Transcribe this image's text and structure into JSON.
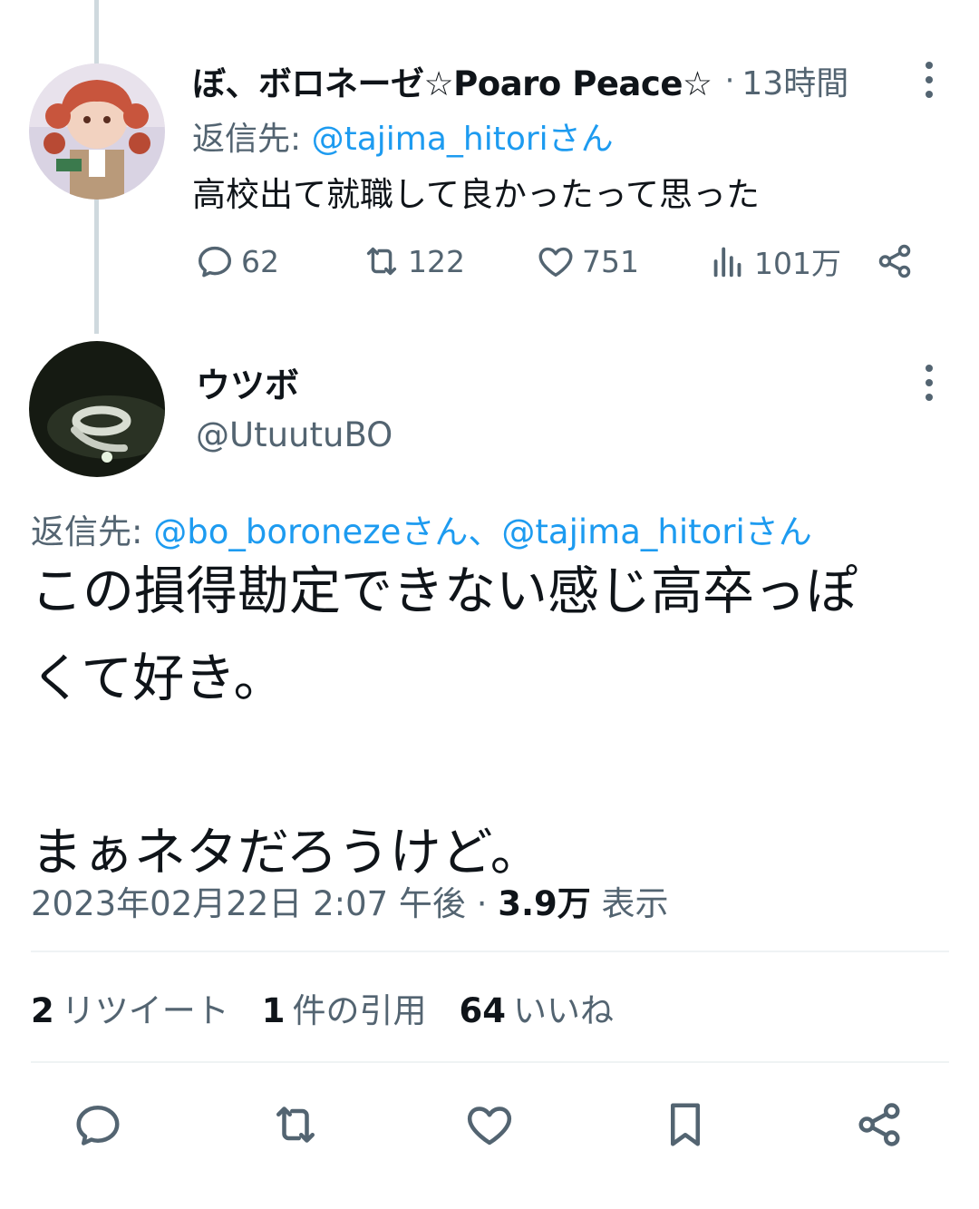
{
  "parent_tweet": {
    "display_name": "ぼ、ボロネーゼ☆Poaro Peace☆",
    "separator": "·",
    "time": "13時間",
    "reply_to_prefix": "返信先: ",
    "reply_to_handle": "@tajima_hitori",
    "reply_to_suffix": "さん",
    "text": "高校出て就職して良かったって思った",
    "replies": "62",
    "retweets": "122",
    "likes": "751",
    "views": "101万"
  },
  "reply_tweet": {
    "display_name": "ウツボ",
    "handle": "@UtuutuBO",
    "reply_to_prefix": "返信先: ",
    "reply_to_handle_1": "@bo_boroneze",
    "reply_to_join": "さん、",
    "reply_to_handle_2": "@tajima_hitori",
    "reply_to_suffix": "さん",
    "body_lines": [
      "この損得勘定できない感じ高卒っぽ",
      "くて好き。",
      "",
      "まぁネタだろうけど。"
    ],
    "timestamp": "2023年02月22日 2:07 午後",
    "meta_separator": " · ",
    "view_count": "3.9万",
    "view_label": " 表示",
    "stats": {
      "retweet_count": "2",
      "retweet_label": "リツイート",
      "quote_count": "1",
      "quote_label": "件の引用",
      "like_count": "64",
      "like_label": "いいね"
    }
  },
  "colors": {
    "text_primary": "#0f1419",
    "text_secondary": "#536471",
    "link": "#1d9bf0",
    "thread_line": "#cfd9de",
    "divider": "#eff3f4"
  },
  "icons": [
    "more-vertical-icon",
    "reply-icon",
    "retweet-icon",
    "like-icon",
    "views-icon",
    "share-icon",
    "bookmark-icon"
  ]
}
